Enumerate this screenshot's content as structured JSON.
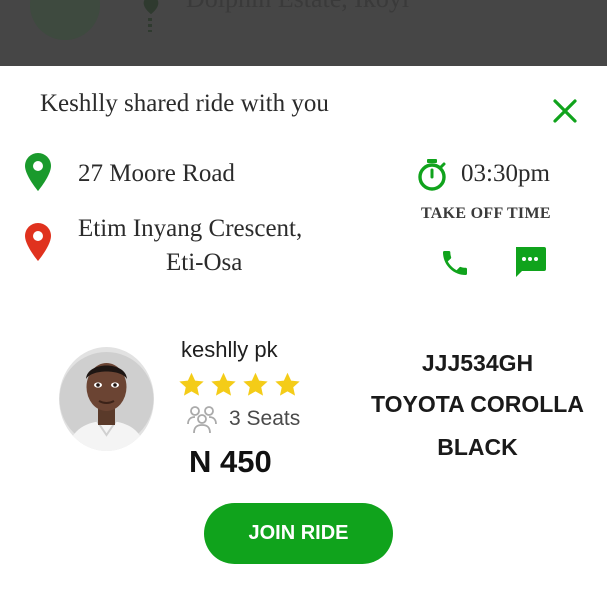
{
  "colors": {
    "brand_green": "#10a31c",
    "pickup_pin": "#1a9a2c",
    "dropoff_pin": "#e0321e",
    "star": "#f4cc18",
    "backdrop": "#464646"
  },
  "icons": {
    "close": "close-icon",
    "pickup": "map-pin-icon",
    "dropoff": "map-pin-icon",
    "timer": "stopwatch-icon",
    "call": "phone-icon",
    "message": "chat-icon",
    "seats": "people-icon",
    "rating": "star-icon"
  },
  "header": {
    "title": "Keshlly shared ride with you"
  },
  "route": {
    "pickup": "27 Moore Road",
    "dropoff_line1": "Etim Inyang Crescent,",
    "dropoff_line2": "Eti-Osa"
  },
  "schedule": {
    "time": "03:30pm",
    "label": "TAKE OFF TIME"
  },
  "driver": {
    "name": "keshlly pk",
    "rating": 4,
    "max_rating": 4,
    "seats": "3 Seats",
    "price": "N 450"
  },
  "vehicle": {
    "plate": "JJJ534GH",
    "model": "TOYOTA COROLLA",
    "color": "BLACK"
  },
  "actions": {
    "join": "JOIN RIDE"
  }
}
